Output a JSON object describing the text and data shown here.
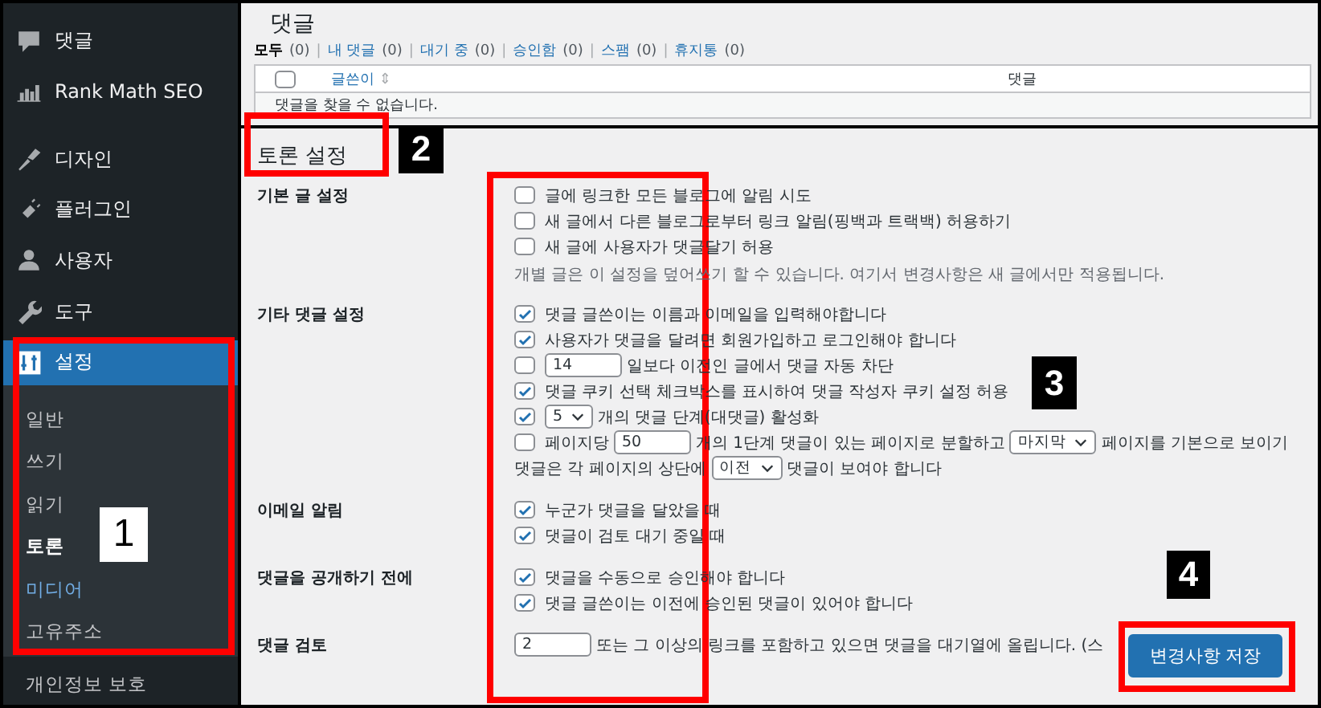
{
  "sidebar": {
    "items": [
      {
        "label": "댓글",
        "selected": false
      },
      {
        "label": "Rank Math SEO",
        "selected": false
      },
      {
        "label": "디자인",
        "selected": false
      },
      {
        "label": "플러그인",
        "selected": false
      },
      {
        "label": "사용자",
        "selected": false
      },
      {
        "label": "도구",
        "selected": false
      },
      {
        "label": "설정",
        "selected": true
      }
    ],
    "submenu": [
      {
        "label": "일반",
        "selected": false,
        "hovered": false
      },
      {
        "label": "쓰기",
        "selected": false,
        "hovered": false
      },
      {
        "label": "읽기",
        "selected": false,
        "hovered": false
      },
      {
        "label": "토론",
        "selected": true,
        "hovered": false
      },
      {
        "label": "미디어",
        "selected": false,
        "hovered": true
      },
      {
        "label": "고유주소",
        "selected": false,
        "hovered": false
      }
    ],
    "after": [
      {
        "label": "개인정보 보호",
        "selected": false
      }
    ]
  },
  "comments_list": {
    "title": "댓글",
    "separator": "|",
    "filters": [
      {
        "label": "모두",
        "count": "(0)",
        "selected": true
      },
      {
        "label": "내 댓글",
        "count": "(0)",
        "selected": false
      },
      {
        "label": "대기 중",
        "count": "(0)",
        "selected": false
      },
      {
        "label": "승인함",
        "count": "(0)",
        "selected": false
      },
      {
        "label": "스팸",
        "count": "(0)",
        "selected": false
      },
      {
        "label": "휴지통",
        "count": "(0)",
        "selected": false
      }
    ],
    "select_all_checked": false,
    "columns": [
      {
        "label": "글쓴이",
        "sort_icon": "⇕"
      },
      {
        "label": "댓글"
      }
    ],
    "empty_message": "댓글을 찾을 수 없습니다."
  },
  "settings": {
    "title": "토론 설정",
    "sections": [
      {
        "label": "기본 글 설정",
        "options": [
          {
            "kind": "option",
            "checked": false,
            "parts": [
              {
                "kind": "text",
                "text": "글에 링크한 모든 블로그에 알림 시도"
              }
            ]
          },
          {
            "kind": "option",
            "checked": false,
            "parts": [
              {
                "kind": "text",
                "text": "새 글에서 다른 블로그로부터 링크 알림(핑백과 트랙백) 허용하기"
              }
            ]
          },
          {
            "kind": "option",
            "checked": false,
            "parts": [
              {
                "kind": "text",
                "text": "새 글에 사용자가 댓글달기 허용"
              }
            ]
          },
          {
            "kind": "note",
            "text": "개별 글은 이 설정을 덮어쓰기 할 수 있습니다. 여기서 변경사항은 새 글에서만 적용됩니다."
          }
        ]
      },
      {
        "label": "기타 댓글 설정",
        "options": [
          {
            "kind": "option",
            "checked": true,
            "parts": [
              {
                "kind": "text",
                "text": "댓글 글쓴이는 이름과 이메일을 입력해야합니다"
              }
            ]
          },
          {
            "kind": "option",
            "checked": true,
            "parts": [
              {
                "kind": "text",
                "text": "사용자가 댓글을 달려면 회원가입하고 로그인해야 합니다"
              }
            ]
          },
          {
            "kind": "option",
            "checked": false,
            "parts": [
              {
                "kind": "input",
                "value": "14"
              },
              {
                "kind": "text",
                "text": "일보다 이전인 글에서 댓글 자동 차단"
              }
            ]
          },
          {
            "kind": "option",
            "checked": true,
            "parts": [
              {
                "kind": "text",
                "text": "댓글 쿠키 선택 체크박스를 표시하여 댓글 작성자 쿠키 설정 허용"
              }
            ]
          },
          {
            "kind": "option",
            "checked": true,
            "parts": [
              {
                "kind": "select",
                "value": "5"
              },
              {
                "kind": "text",
                "text": "개의 댓글 단계(대댓글) 활성화"
              }
            ]
          },
          {
            "kind": "option",
            "checked": false,
            "parts": [
              {
                "kind": "text",
                "text": "페이지당"
              },
              {
                "kind": "input",
                "value": "50"
              },
              {
                "kind": "text",
                "text": "개의 1단계 댓글이 있는 페이지로 분할하고"
              },
              {
                "kind": "select",
                "value": "마지막"
              },
              {
                "kind": "text",
                "text": "페이지를 기본으로 보이기"
              }
            ]
          },
          {
            "kind": "line",
            "parts": [
              {
                "kind": "text",
                "text": "댓글은 각 페이지의 상단에"
              },
              {
                "kind": "select",
                "value": "이전"
              },
              {
                "kind": "text",
                "text": "댓글이 보여야 합니다"
              }
            ]
          }
        ]
      },
      {
        "label": "이메일 알림",
        "options": [
          {
            "kind": "option",
            "checked": true,
            "parts": [
              {
                "kind": "text",
                "text": "누군가 댓글을 달았을 때"
              }
            ]
          },
          {
            "kind": "option",
            "checked": true,
            "parts": [
              {
                "kind": "text",
                "text": "댓글이 검토 대기 중일 때"
              }
            ]
          }
        ]
      },
      {
        "label": "댓글을 공개하기 전에",
        "options": [
          {
            "kind": "option",
            "checked": true,
            "parts": [
              {
                "kind": "text",
                "text": "댓글을 수동으로 승인해야 합니다"
              }
            ]
          },
          {
            "kind": "option",
            "checked": true,
            "parts": [
              {
                "kind": "text",
                "text": "댓글 글쓴이는 이전에 승인된 댓글이 있어야 합니다"
              }
            ]
          }
        ]
      },
      {
        "label": "댓글 검토",
        "options": [
          {
            "kind": "line",
            "parts": [
              {
                "kind": "input",
                "value": "2"
              },
              {
                "kind": "text",
                "text": "또는 그 이상의 링크를 포함하고 있으면 댓글을 대기열에 올립니다. (스"
              }
            ]
          }
        ]
      }
    ]
  },
  "save_button": "변경사항 저장",
  "annotations": [
    {
      "number": "1",
      "kind": "light"
    },
    {
      "number": "2",
      "kind": "dark"
    },
    {
      "number": "3",
      "kind": "dark"
    },
    {
      "number": "4",
      "kind": "dark"
    }
  ]
}
